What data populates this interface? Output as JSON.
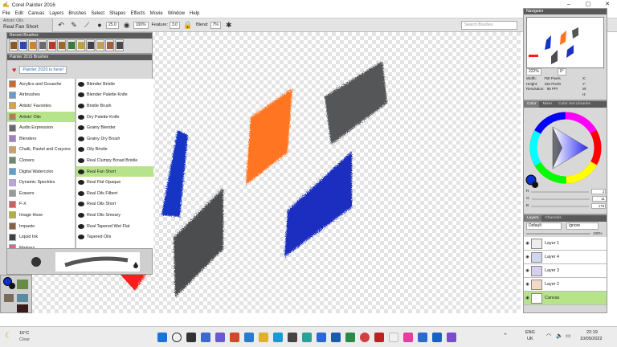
{
  "app": {
    "title": "Corel Painter 2016",
    "window_buttons": [
      "–",
      "▢",
      "✕"
    ]
  },
  "menu": [
    "File",
    "Edit",
    "Canvas",
    "Layers",
    "Brushes",
    "Select",
    "Shapes",
    "Effects",
    "Movie",
    "Window",
    "Help"
  ],
  "propbar": {
    "brush_category": "Artists' Oils",
    "brush_variant": "Real Fan Short",
    "size_value": "25.0",
    "opacity_value": "100%",
    "feature_label": "Feature:",
    "feature_value": "3.0",
    "blend_label": "Blend:",
    "blend_value": "7%",
    "search_placeholder": "Search Brushes"
  },
  "recent": {
    "title": "Recent Brushes",
    "swatch_colors": [
      "#8a5a2a",
      "#2a4ab0",
      "#c8872a",
      "#6a6a6a",
      "#b53a2a",
      "#9a6a2a",
      "#3a7a3a",
      "#c0a040",
      "#444444",
      "#c4a060",
      "#a06040",
      "#4a4a4a"
    ]
  },
  "brush_library": {
    "title": "Painter 2016 Brushes",
    "promo": "Painter 2020 is here!",
    "categories": [
      "Acrylics and Gouache",
      "Airbrushes",
      "Artists' Favorites",
      "Artists' Oils",
      "Audio Expression",
      "Blenders",
      "Chalk, Pastel and Crayons",
      "Cloners",
      "Digital Watercolor",
      "Dynamic Speckles",
      "Erasers",
      "F-X",
      "Image Hose",
      "Impasto",
      "Liquid Ink",
      "Markers"
    ],
    "selected_category": 3,
    "variants": [
      "Blender Bristle",
      "Blender Palette Knife",
      "Bristle Brush",
      "Dry Palette Knife",
      "Grainy Blender",
      "Grainy Dry Brush",
      "Oily Bristle",
      "Real Clumpy Broad Bristle",
      "Real Fan Short",
      "Real Flat Opaque",
      "Real Oils Filbert",
      "Real Oils Short",
      "Real Oils Smeary",
      "Real Tapered Wet Flat",
      "Tapered Oils"
    ],
    "selected_variant": 8
  },
  "navigator": {
    "title": "Navigator",
    "zoom": "222%",
    "rotation": "0°",
    "width_label": "Width:",
    "width_value": "768 Pixels",
    "height_label": "Height:",
    "height_value": "432 Pixels",
    "res_label": "Resolution:",
    "res_value": "96 PPI",
    "x_label": "X:",
    "y_label": "Y:",
    "w_label": "W:",
    "h_label": "H:"
  },
  "color": {
    "tabs": [
      "Color",
      "Mixer",
      "Color Set Libraries"
    ],
    "main_color": "#0b2fd0",
    "r_label": "R",
    "r_value": "2",
    "g_label": "G",
    "g_value": "11",
    "b_label": "B",
    "b_value": "176"
  },
  "layers": {
    "tabs": [
      "Layers",
      "Channels"
    ],
    "composite": "Default",
    "opacity": "100%",
    "ignore": "Ignore",
    "items": [
      "Layer 1",
      "Layer 4",
      "Layer 3",
      "Layer 2",
      "Canvas"
    ],
    "selected": 4
  },
  "taskbar": {
    "weather_temp": "16°C",
    "weather_text": "Clear",
    "lang1": "ENG",
    "lang2": "UK",
    "time": "22:19",
    "date": "10/05/2022"
  }
}
